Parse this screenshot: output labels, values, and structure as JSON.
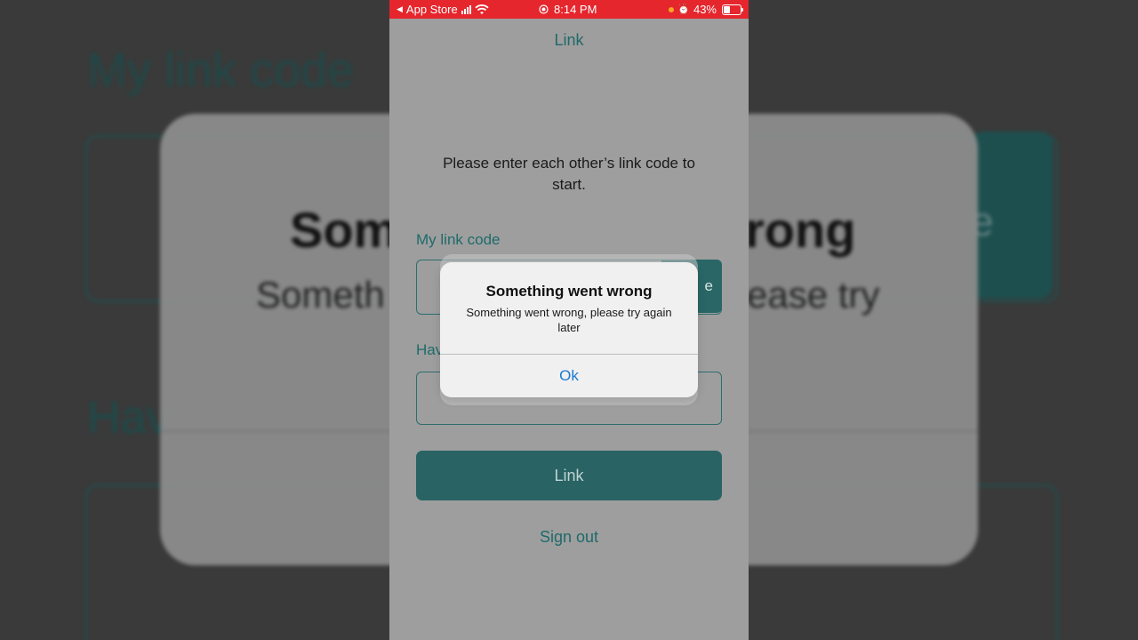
{
  "status_bar": {
    "back_app": "App Store",
    "time": "8:14 PM",
    "battery": "43%"
  },
  "nav": {
    "title": "Link"
  },
  "instruction": "Please enter each other’s link code to start.",
  "my_code": {
    "label": "My link code"
  },
  "their_code": {
    "label": "Hav"
  },
  "share_button": {
    "label": "e"
  },
  "link_button": {
    "label": "Link"
  },
  "sign_out": {
    "label": "Sign out"
  },
  "alert": {
    "title": "Something went wrong",
    "message": "Something went wrong, please try again later",
    "ok_label": "Ok"
  },
  "backdrop": {
    "title": "My link code",
    "card_title_left": "Som",
    "card_title_right": "rong",
    "card_sub_left": "Someth",
    "card_sub_right": "ease try",
    "hav": "Hav",
    "teal_letter": "e"
  },
  "colors": {
    "status_bar": "#e5262d",
    "accent": "#1f6a6a",
    "button": "#296363",
    "alert_link": "#1a7ad0"
  }
}
